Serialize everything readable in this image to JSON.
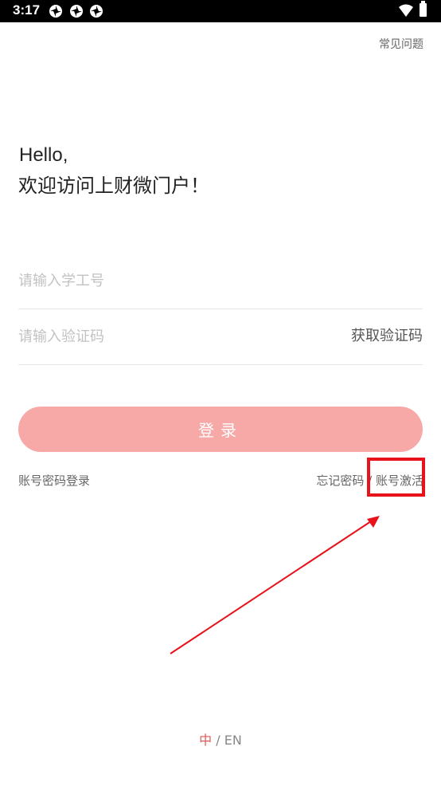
{
  "status_bar": {
    "time": "3:17",
    "icons": [
      "app-notification-icon",
      "app-notification-icon",
      "app-notification-icon",
      "wifi-icon",
      "battery-icon"
    ]
  },
  "header": {
    "faq": "常见问题"
  },
  "greeting": {
    "hello": "Hello,",
    "welcome": "欢迎访问上财微门户！"
  },
  "form": {
    "id_placeholder": "请输入学工号",
    "code_placeholder": "请输入验证码",
    "get_code": "获取验证码",
    "login": "登录"
  },
  "links": {
    "password_login": "账号密码登录",
    "forgot_password": "忘记密码",
    "separator": " / ",
    "activate_account": "账号激活"
  },
  "language": {
    "zh": "中",
    "separator": " / ",
    "en": "EN"
  },
  "annotation": {
    "color": "#e8121b"
  },
  "colors": {
    "login_button": "#f7a9a8",
    "accent": "#e05a5a"
  }
}
